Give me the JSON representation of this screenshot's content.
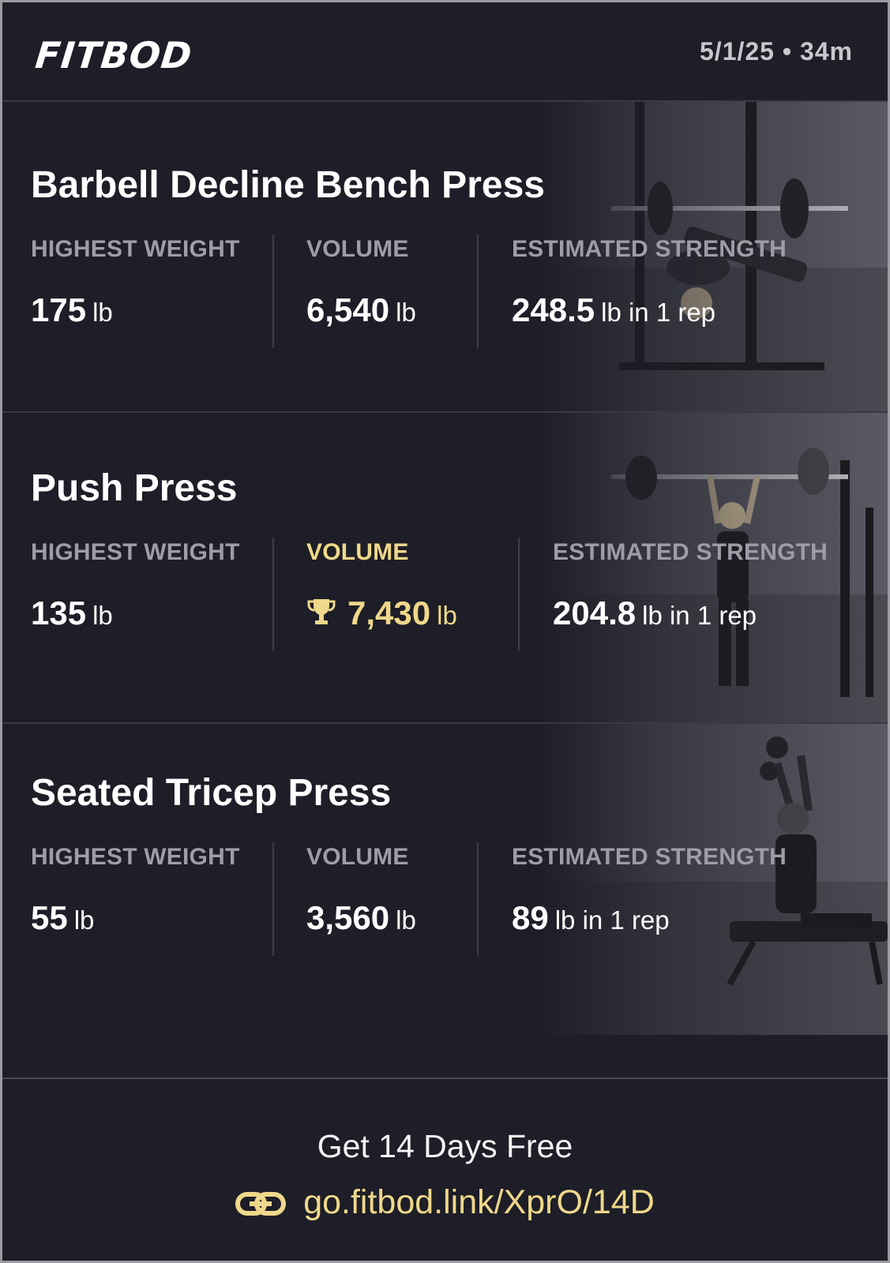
{
  "header": {
    "logo": "FITBOD",
    "meta": "5/1/25 • 34m"
  },
  "labels": {
    "highest_weight": "HIGHEST WEIGHT",
    "volume": "VOLUME",
    "estimated_strength": "ESTIMATED STRENGTH"
  },
  "exercises": [
    {
      "name": "Barbell Decline Bench Press",
      "highest_weight": {
        "value": "175",
        "unit": "lb"
      },
      "volume": {
        "value": "6,540",
        "unit": "lb",
        "record": false
      },
      "estimated_strength": {
        "value": "248.5",
        "unit": "lb in 1 rep"
      }
    },
    {
      "name": "Push Press",
      "highest_weight": {
        "value": "135",
        "unit": "lb"
      },
      "volume": {
        "value": "7,430",
        "unit": "lb",
        "record": true
      },
      "estimated_strength": {
        "value": "204.8",
        "unit": "lb in 1 rep"
      }
    },
    {
      "name": "Seated Tricep Press",
      "highest_weight": {
        "value": "55",
        "unit": "lb"
      },
      "volume": {
        "value": "3,560",
        "unit": "lb",
        "record": false
      },
      "estimated_strength": {
        "value": "89",
        "unit": "lb in 1 rep"
      }
    }
  ],
  "footer": {
    "promo": "Get 14 Days Free",
    "link": "go.fitbod.link/XprO/14D",
    "link_icon": "link-icon"
  },
  "colors": {
    "background": "#1e1e28",
    "accent_gold": "#efd88a",
    "label_gray": "#9d9da6"
  }
}
